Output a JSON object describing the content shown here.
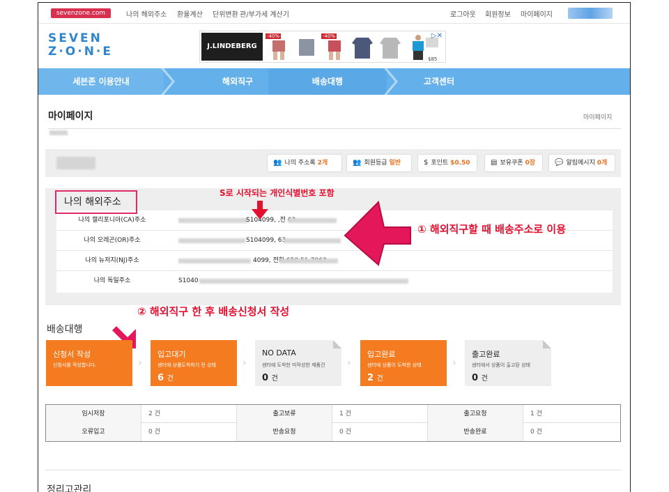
{
  "topbar": {
    "logo": "sevenzone.com",
    "left_links": [
      "나의 해외주소",
      "환율계산",
      "단위변환",
      "관/부가세 계산기"
    ],
    "right_links": [
      "로그아웃",
      "회원정보",
      "마이페이지"
    ]
  },
  "header": {
    "logo_line1": "SEVEN",
    "logo_line2": "Z·O·N·E",
    "ad": {
      "brand": "J.LINDEBERG",
      "badges": [
        "-40%",
        "-40%"
      ],
      "price": "$85"
    }
  },
  "nav": [
    "세븐존 이용안내",
    "해외직구",
    "배송대행",
    "고객센터"
  ],
  "page": {
    "title": "마이페이지",
    "breadcrumb": "마이페이지"
  },
  "summary": {
    "pills": [
      {
        "label": "나의 주소록",
        "value": "2개",
        "icon": "address-book-icon"
      },
      {
        "label": "회원등급",
        "value": "일반",
        "icon": "member-grade-icon"
      },
      {
        "label": "포인트",
        "value": "$0.50",
        "icon": "point-icon"
      },
      {
        "label": "보유쿠폰",
        "value": "0장",
        "icon": "coupon-icon"
      },
      {
        "label": "알림메시지",
        "value": "0개",
        "icon": "message-icon"
      }
    ]
  },
  "addresses": {
    "title": "나의 해외주소",
    "rows": [
      {
        "label": "나의 캘리포니아(CA)주소",
        "value": "S104099, ,전 63"
      },
      {
        "label": "나의 오레곤(OR)주소",
        "value": "S104099, 63"
      },
      {
        "label": "나의 뉴저지(NJ)주소",
        "value": "4099, 전화 650 51-7063"
      },
      {
        "label": "나의 독일주소",
        "value": "S1040"
      }
    ]
  },
  "annotations": {
    "id_note": "S로 시작되는 개인식별번호 포함",
    "note1": "① 해외직구할 때 배송주소로 이용",
    "note2": "② 해외직구 한 후 배송신청서 작성"
  },
  "delivery": {
    "title": "배송대행",
    "cards": [
      {
        "title": "신청서 작성",
        "desc": "신청서를 작성합니다.",
        "count": "",
        "unit": ""
      },
      {
        "title": "입고대기",
        "desc": "센터에 상품도착하기 전 상태",
        "count": "6",
        "unit": "건"
      },
      {
        "title": "NO DATA",
        "desc": "센터에 도착한 미작성한 제품건",
        "count": "0",
        "unit": "건"
      },
      {
        "title": "입고완료",
        "desc": "센터에 상품이 도착한 상태",
        "count": "2",
        "unit": "건"
      },
      {
        "title": "출고완료",
        "desc": "센터에서 상품이 출고된 상태",
        "count": "0",
        "unit": "건"
      }
    ]
  },
  "status_table": [
    [
      {
        "label": "임시저장",
        "value": "2 건"
      },
      {
        "label": "출고보류",
        "value": "1 건"
      },
      {
        "label": "출고요청",
        "value": "1 건"
      }
    ],
    [
      {
        "label": "오류입고",
        "value": "0 건"
      },
      {
        "label": "반송요청",
        "value": "0 건"
      },
      {
        "label": "반송완료",
        "value": "0 건"
      }
    ]
  ],
  "next_section": {
    "title": "정리고관리"
  },
  "colors": {
    "nav": "#64b0ea",
    "accent_orange": "#f47b20",
    "annotation_red": "#e3102f",
    "highlight_pink": "#e02a68"
  }
}
